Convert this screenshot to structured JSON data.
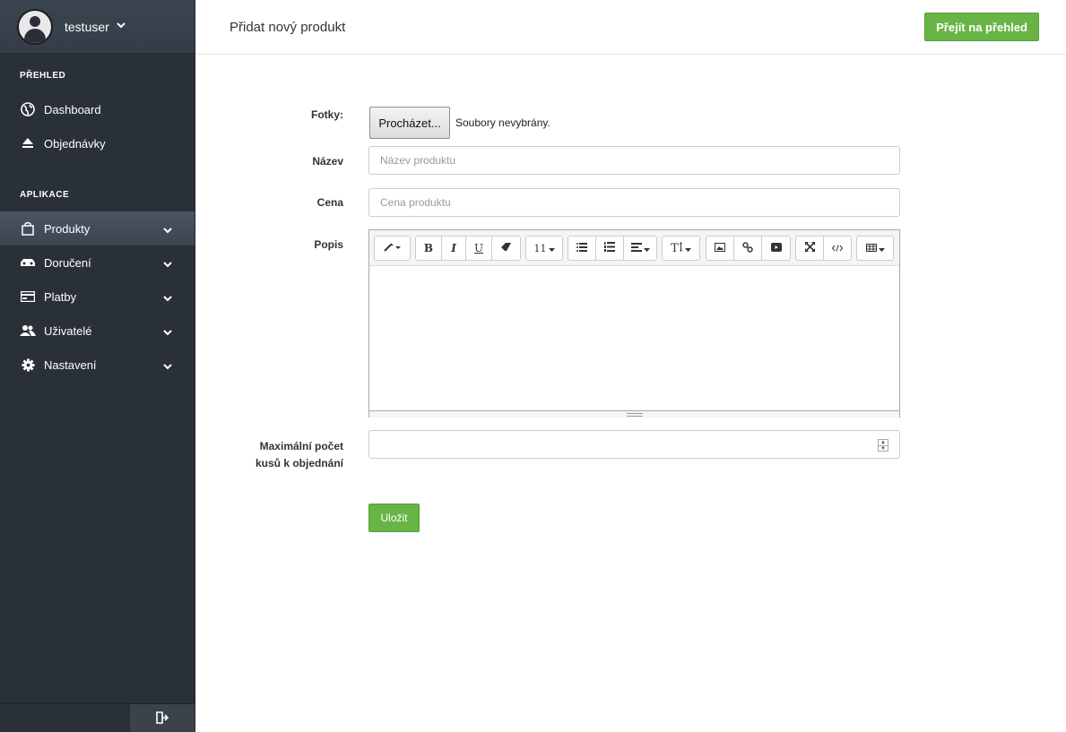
{
  "user": {
    "name": "testuser"
  },
  "sidebar": {
    "sections": [
      {
        "title": "PŘEHLED",
        "items": [
          {
            "label": "Dashboard",
            "icon": "globe-icon"
          },
          {
            "label": "Objednávky",
            "icon": "eject-icon"
          }
        ]
      },
      {
        "title": "APLIKACE",
        "items": [
          {
            "label": "Produkty",
            "icon": "shopping-bag-icon",
            "active": true
          },
          {
            "label": "Doručení",
            "icon": "car-icon"
          },
          {
            "label": "Platby",
            "icon": "credit-card-icon"
          },
          {
            "label": "Uživatelé",
            "icon": "users-icon"
          },
          {
            "label": "Nastavení",
            "icon": "gear-icon"
          }
        ]
      }
    ]
  },
  "header": {
    "title": "Přidat nový produkt",
    "overview_button": "Přejít na přehled"
  },
  "form": {
    "photos_label": "Fotky:",
    "browse_button": "Procházet...",
    "no_files_text": "Soubory nevybrány.",
    "name_label": "Název",
    "name_placeholder": "Název produktu",
    "price_label": "Cena",
    "price_placeholder": "Cena produktu",
    "description_label": "Popis",
    "max_label_line1": "Maximální počet",
    "max_label_line2": "kusů k objednání",
    "save_button": "Uložit"
  },
  "editor": {
    "font_size": "11",
    "bold": "B",
    "italic": "I",
    "underline": "U",
    "text_style": "T"
  },
  "colors": {
    "accent": "#69b446",
    "sidebar": "#2a3038"
  }
}
